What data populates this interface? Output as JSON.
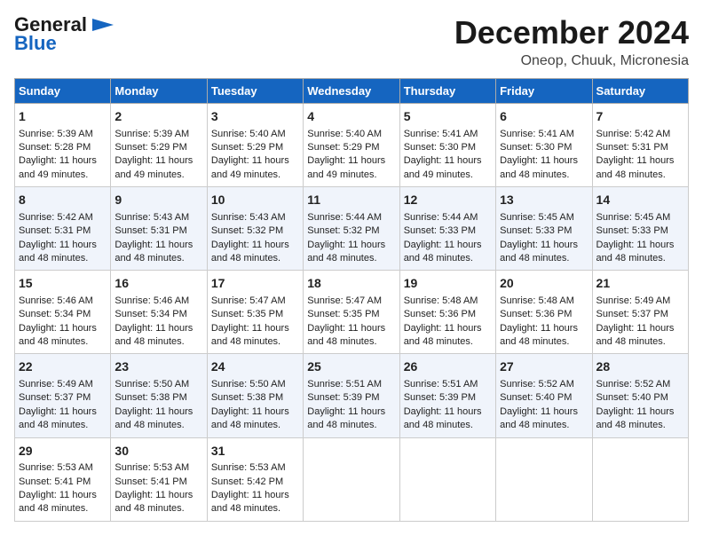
{
  "logo": {
    "line1": "General",
    "line2": "Blue"
  },
  "title": "December 2024",
  "subtitle": "Oneop, Chuuk, Micronesia",
  "days_of_week": [
    "Sunday",
    "Monday",
    "Tuesday",
    "Wednesday",
    "Thursday",
    "Friday",
    "Saturday"
  ],
  "weeks": [
    [
      {
        "day": "1",
        "rise": "5:39 AM",
        "set": "5:28 PM",
        "daylight": "11 hours and 49 minutes."
      },
      {
        "day": "2",
        "rise": "5:39 AM",
        "set": "5:29 PM",
        "daylight": "11 hours and 49 minutes."
      },
      {
        "day": "3",
        "rise": "5:40 AM",
        "set": "5:29 PM",
        "daylight": "11 hours and 49 minutes."
      },
      {
        "day": "4",
        "rise": "5:40 AM",
        "set": "5:29 PM",
        "daylight": "11 hours and 49 minutes."
      },
      {
        "day": "5",
        "rise": "5:41 AM",
        "set": "5:30 PM",
        "daylight": "11 hours and 49 minutes."
      },
      {
        "day": "6",
        "rise": "5:41 AM",
        "set": "5:30 PM",
        "daylight": "11 hours and 48 minutes."
      },
      {
        "day": "7",
        "rise": "5:42 AM",
        "set": "5:31 PM",
        "daylight": "11 hours and 48 minutes."
      }
    ],
    [
      {
        "day": "8",
        "rise": "5:42 AM",
        "set": "5:31 PM",
        "daylight": "11 hours and 48 minutes."
      },
      {
        "day": "9",
        "rise": "5:43 AM",
        "set": "5:31 PM",
        "daylight": "11 hours and 48 minutes."
      },
      {
        "day": "10",
        "rise": "5:43 AM",
        "set": "5:32 PM",
        "daylight": "11 hours and 48 minutes."
      },
      {
        "day": "11",
        "rise": "5:44 AM",
        "set": "5:32 PM",
        "daylight": "11 hours and 48 minutes."
      },
      {
        "day": "12",
        "rise": "5:44 AM",
        "set": "5:33 PM",
        "daylight": "11 hours and 48 minutes."
      },
      {
        "day": "13",
        "rise": "5:45 AM",
        "set": "5:33 PM",
        "daylight": "11 hours and 48 minutes."
      },
      {
        "day": "14",
        "rise": "5:45 AM",
        "set": "5:33 PM",
        "daylight": "11 hours and 48 minutes."
      }
    ],
    [
      {
        "day": "15",
        "rise": "5:46 AM",
        "set": "5:34 PM",
        "daylight": "11 hours and 48 minutes."
      },
      {
        "day": "16",
        "rise": "5:46 AM",
        "set": "5:34 PM",
        "daylight": "11 hours and 48 minutes."
      },
      {
        "day": "17",
        "rise": "5:47 AM",
        "set": "5:35 PM",
        "daylight": "11 hours and 48 minutes."
      },
      {
        "day": "18",
        "rise": "5:47 AM",
        "set": "5:35 PM",
        "daylight": "11 hours and 48 minutes."
      },
      {
        "day": "19",
        "rise": "5:48 AM",
        "set": "5:36 PM",
        "daylight": "11 hours and 48 minutes."
      },
      {
        "day": "20",
        "rise": "5:48 AM",
        "set": "5:36 PM",
        "daylight": "11 hours and 48 minutes."
      },
      {
        "day": "21",
        "rise": "5:49 AM",
        "set": "5:37 PM",
        "daylight": "11 hours and 48 minutes."
      }
    ],
    [
      {
        "day": "22",
        "rise": "5:49 AM",
        "set": "5:37 PM",
        "daylight": "11 hours and 48 minutes."
      },
      {
        "day": "23",
        "rise": "5:50 AM",
        "set": "5:38 PM",
        "daylight": "11 hours and 48 minutes."
      },
      {
        "day": "24",
        "rise": "5:50 AM",
        "set": "5:38 PM",
        "daylight": "11 hours and 48 minutes."
      },
      {
        "day": "25",
        "rise": "5:51 AM",
        "set": "5:39 PM",
        "daylight": "11 hours and 48 minutes."
      },
      {
        "day": "26",
        "rise": "5:51 AM",
        "set": "5:39 PM",
        "daylight": "11 hours and 48 minutes."
      },
      {
        "day": "27",
        "rise": "5:52 AM",
        "set": "5:40 PM",
        "daylight": "11 hours and 48 minutes."
      },
      {
        "day": "28",
        "rise": "5:52 AM",
        "set": "5:40 PM",
        "daylight": "11 hours and 48 minutes."
      }
    ],
    [
      {
        "day": "29",
        "rise": "5:53 AM",
        "set": "5:41 PM",
        "daylight": "11 hours and 48 minutes."
      },
      {
        "day": "30",
        "rise": "5:53 AM",
        "set": "5:41 PM",
        "daylight": "11 hours and 48 minutes."
      },
      {
        "day": "31",
        "rise": "5:53 AM",
        "set": "5:42 PM",
        "daylight": "11 hours and 48 minutes."
      },
      null,
      null,
      null,
      null
    ]
  ],
  "labels": {
    "sunrise": "Sunrise:",
    "sunset": "Sunset:",
    "daylight": "Daylight:"
  }
}
